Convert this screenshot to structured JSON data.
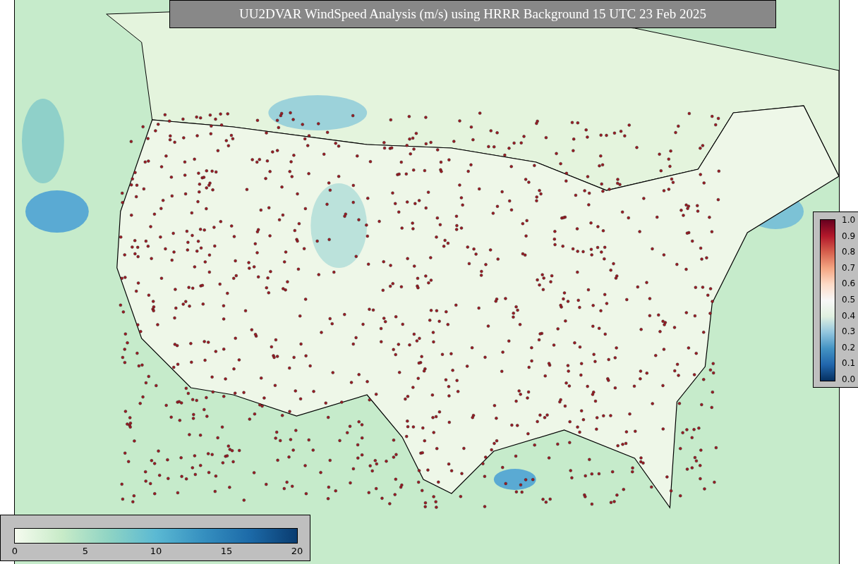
{
  "title": "UU2DVAR WindSpeed Analysis (m/s) using HRRR Background 15 UTC 23 Feb 2025",
  "speed_colorbar": {
    "ticks": [
      "0",
      "5",
      "10",
      "15",
      "20"
    ]
  },
  "ratio_colorbar": {
    "ticks": [
      "1.0",
      "0.9",
      "0.8",
      "0.7",
      "0.6",
      "0.5",
      "0.4",
      "0.3",
      "0.2",
      "0.1",
      "0.0"
    ]
  }
}
